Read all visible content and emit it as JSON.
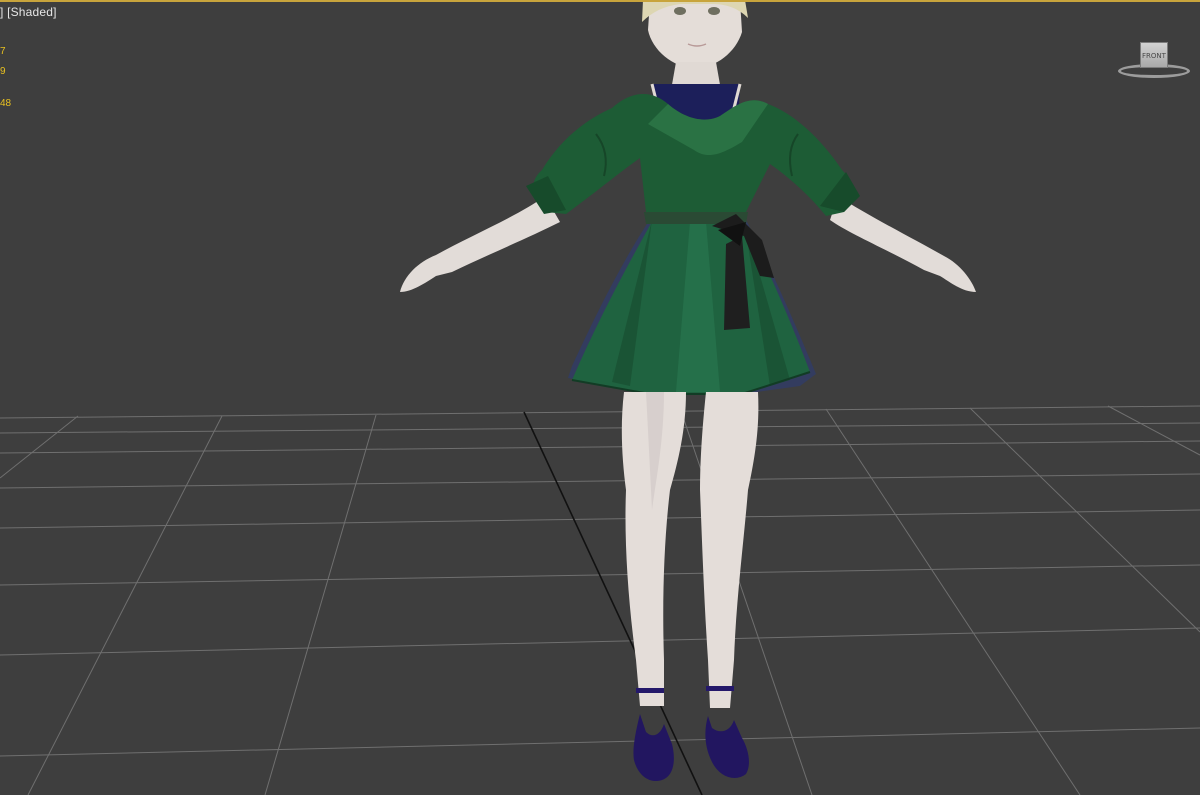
{
  "viewport": {
    "label": "] [Shaded]",
    "active_border_color": "#c8a43c",
    "background_color": "#3e3e3e",
    "grid_color": "#6f6f6f",
    "axis_line_color": "#111111"
  },
  "stats": {
    "text_color": "#e8c020",
    "lines": [
      "7",
      "9",
      "48"
    ]
  },
  "viewcube": {
    "face_label": "FRONT",
    "icon": "viewcube-icon"
  },
  "model": {
    "icon": "character-model",
    "dress_color": "#1e5c36",
    "skin_color": "#e3dcd8",
    "shoe_color": "#221660",
    "bow_color": "#1c1c1c"
  }
}
